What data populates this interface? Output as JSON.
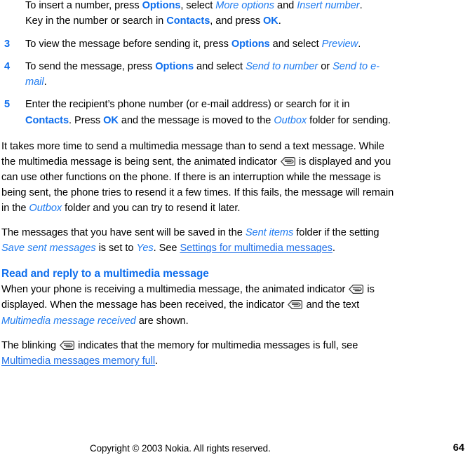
{
  "document": {
    "type": "user-guide-page",
    "accent_blue": "#0d6ded",
    "italic_blue": "#1f7bf0",
    "link_blue": "#1f6fe8",
    "text_color": "#000000",
    "background": "#ffffff"
  },
  "step2_continuation": {
    "line1_a": "To insert a number, press ",
    "line1_b": "Options",
    "line1_c": ", select ",
    "line1_d": "More options",
    "line1_e": " and ",
    "line1_f": "Insert number",
    "line1_g": ".",
    "line2_a": "Key in the number or search in ",
    "line2_b": "Contacts",
    "line2_c": ", and press ",
    "line2_d": "OK",
    "line2_e": "."
  },
  "steps": [
    {
      "number": "3",
      "parts": [
        {
          "text": "To view the message before sending it, press ",
          "style": "plain"
        },
        {
          "text": "Options",
          "style": "ui-bold"
        },
        {
          "text": " and select ",
          "style": "plain"
        },
        {
          "text": "Preview",
          "style": "ui-italic"
        },
        {
          "text": ".",
          "style": "plain"
        }
      ]
    },
    {
      "number": "4",
      "parts": [
        {
          "text": "To send the message, press ",
          "style": "plain"
        },
        {
          "text": "Options",
          "style": "ui-bold"
        },
        {
          "text": " and select ",
          "style": "plain"
        },
        {
          "text": "Send to number",
          "style": "ui-italic"
        },
        {
          "text": " or ",
          "style": "plain"
        },
        {
          "text": "Send to e-mail",
          "style": "ui-italic"
        },
        {
          "text": ".",
          "style": "plain"
        }
      ]
    },
    {
      "number": "5",
      "parts": [
        {
          "text": "Enter the recipient’s phone number (or e-mail address) or search for it in ",
          "style": "plain"
        },
        {
          "text": "Contacts",
          "style": "ui-bold"
        },
        {
          "text": ". Press ",
          "style": "plain"
        },
        {
          "text": "OK",
          "style": "ui-bold"
        },
        {
          "text": " and the message is moved to the ",
          "style": "plain"
        },
        {
          "text": "Outbox",
          "style": "ui-italic"
        },
        {
          "text": " folder for sending.",
          "style": "plain"
        }
      ]
    }
  ],
  "paragraph_sending": {
    "a": "It takes more time to send a multimedia message than to send a text message. While the multimedia message is being sent, the animated indicator ",
    "icon": "mms-indicator-icon",
    "b": " is displayed and you can use other functions on the phone. If there is an interruption while the message is being sent, the phone tries to resend it a few times. If this fails, the message will remain in the ",
    "c": "Outbox",
    "d": " folder and you can try to resend it later."
  },
  "paragraph_sent_items": {
    "a": "The messages that you have sent will be saved in the ",
    "b": "Sent items",
    "c": " folder if the setting ",
    "d": "Save sent messages",
    "e": " is set to ",
    "f": "Yes",
    "g": ". See ",
    "link": "Settings for multimedia messages",
    "h": "."
  },
  "heading": "Read and reply to a multimedia message",
  "paragraph_read": {
    "a": "When your phone is receiving a multimedia message, the animated indicator ",
    "icon1": "mms-indicator-icon",
    "b": " is displayed. When the message has been received, the indicator ",
    "icon2": "mms-indicator-icon",
    "c": " and the text ",
    "d": "Multimedia message received",
    "e": " are shown."
  },
  "paragraph_memory_full": {
    "a": "The blinking ",
    "icon": "mms-indicator-icon",
    "b": " indicates that the memory for multimedia messages is full, see ",
    "link": "Multimedia messages memory full",
    "c": "."
  },
  "footer": {
    "copyright": "Copyright © 2003 Nokia. All rights reserved.",
    "page_number": "64"
  }
}
